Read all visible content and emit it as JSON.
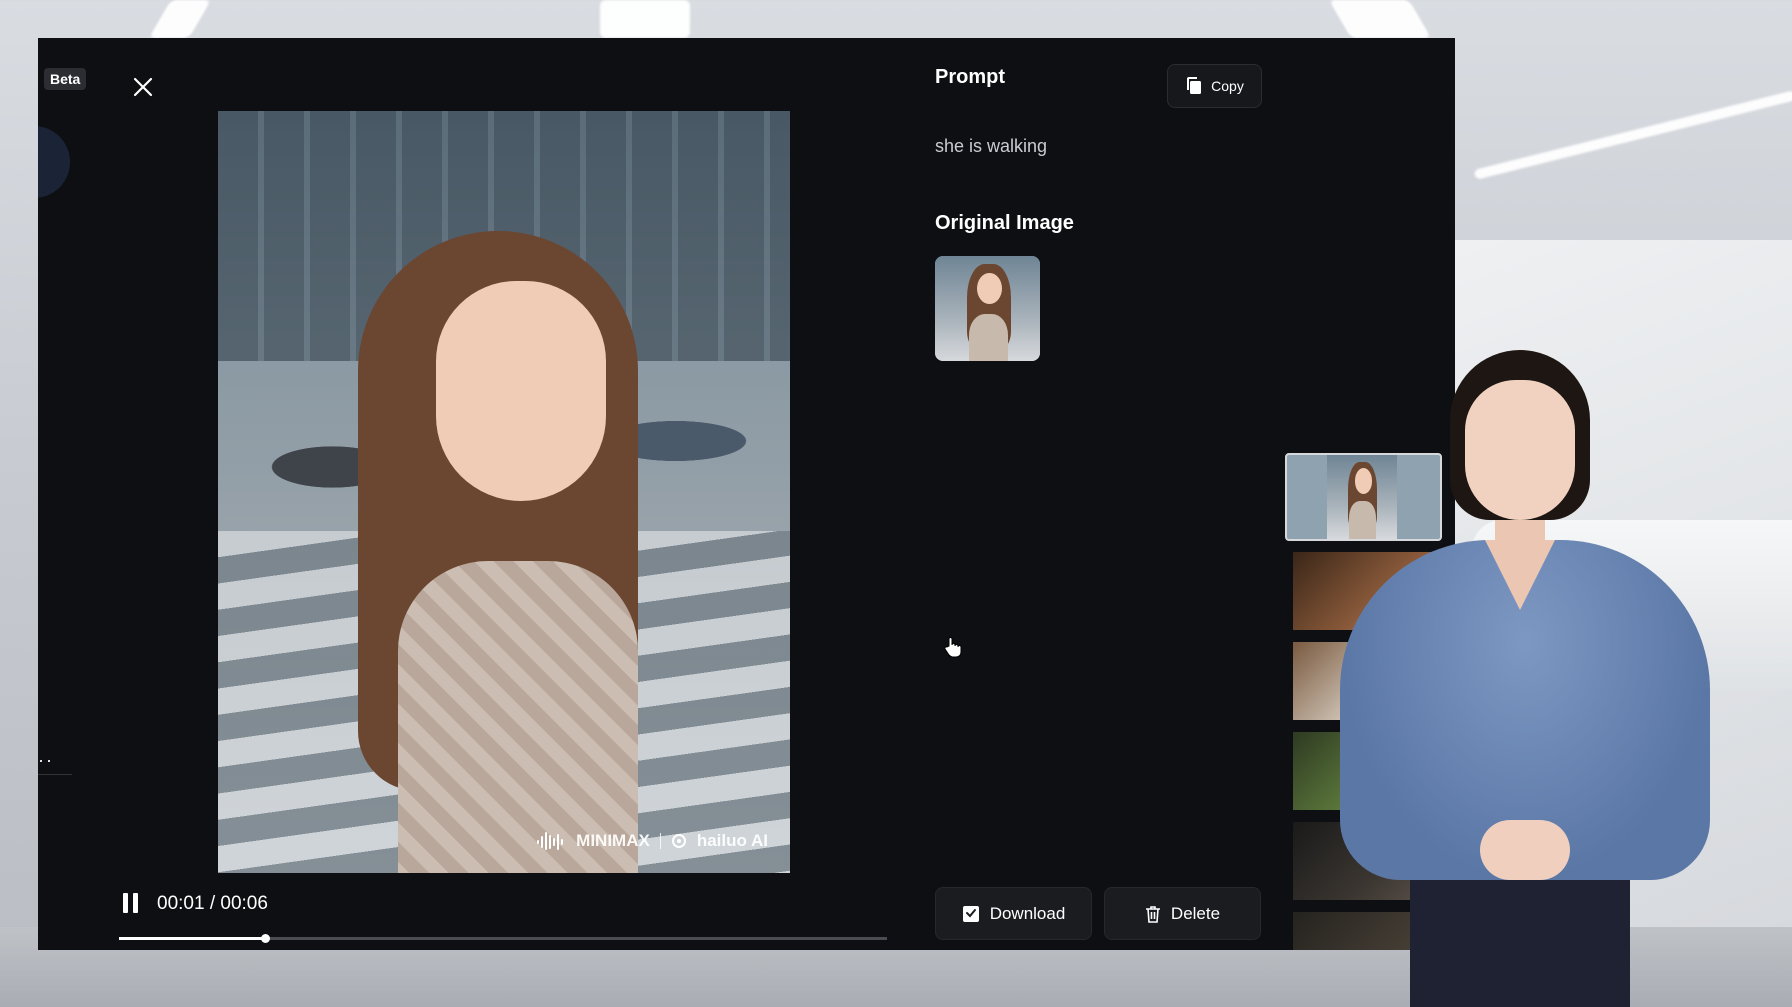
{
  "badge": {
    "beta": "Beta"
  },
  "player": {
    "time": "00:01 / 00:06",
    "progress": 0.19,
    "watermark_brand": "MINIMAX",
    "watermark_app": "hailuo AI"
  },
  "panel": {
    "prompt_title": "Prompt",
    "copy_label": "Copy",
    "prompt_text": "she is walking",
    "original_image_title": "Original Image",
    "download_label": "Download",
    "delete_label": "Delete"
  },
  "history": {
    "items": [
      "video-1",
      "video-2",
      "video-3",
      "video-4",
      "video-5",
      "video-6"
    ],
    "active_index": 0
  },
  "icons": {
    "close": "close-icon",
    "copy": "copy-icon",
    "download": "download-icon",
    "delete": "trash-icon",
    "pause": "pause-icon",
    "cursor": "hand-cursor-icon"
  },
  "colors": {
    "modal_bg": "#0e0f12",
    "button_bg": "#1a1c20",
    "text_secondary": "#c9cbd0"
  }
}
